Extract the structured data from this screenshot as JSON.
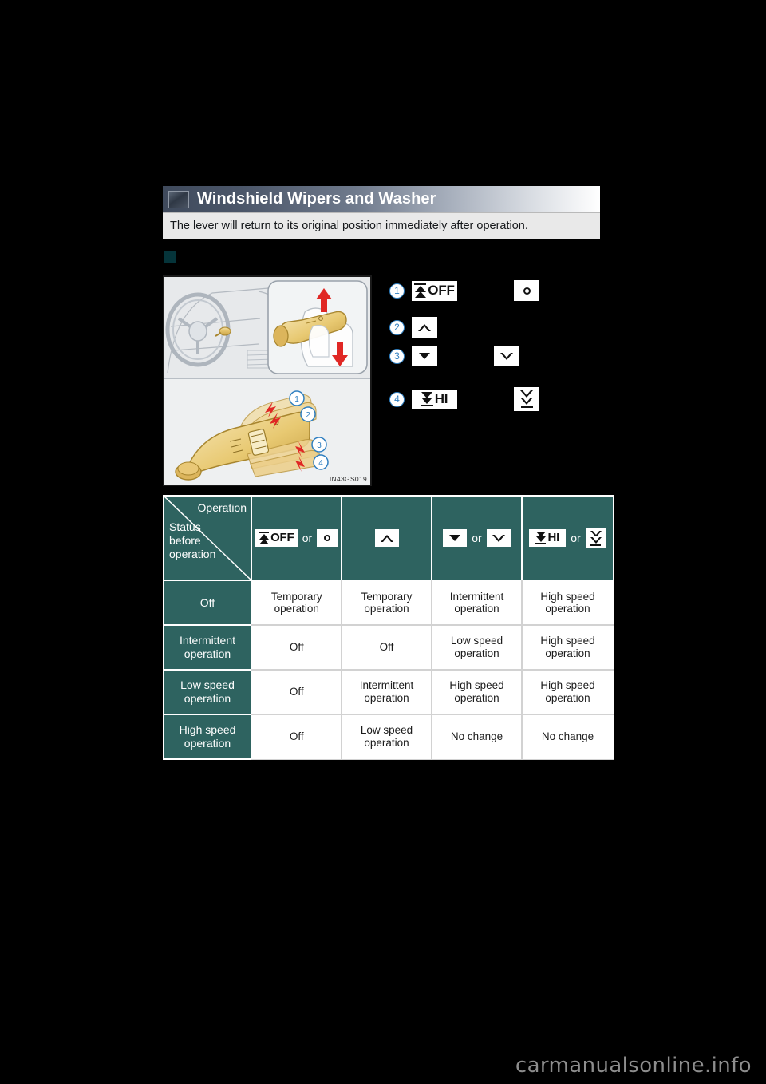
{
  "section": {
    "icon_name": "wiper-thumbnail-icon",
    "title": "Windshield Wipers and Washer",
    "subtitle": "The lever will return to its original position immediately after operation."
  },
  "illustration": {
    "caption_code": "IN43GS019",
    "alt": "Steering column wiper lever with four operating positions"
  },
  "callouts": [
    {
      "num": "1",
      "primary_label": "OFF",
      "primary_icon": "bar-up-arrow-icon",
      "alt_icon": "ring-icon",
      "alt_label": ""
    },
    {
      "num": "2",
      "primary_label": "",
      "primary_icon": "triangle-up-hollow-icon",
      "alt_icon": "",
      "alt_label": ""
    },
    {
      "num": "3",
      "primary_label": "",
      "primary_icon": "triangle-down-solid-icon",
      "alt_icon": "triangle-down-hollow-icon",
      "alt_label": ""
    },
    {
      "num": "4",
      "primary_label": "HI",
      "primary_icon": "bar-down-arrow-icon",
      "alt_icon": "double-down-arrow-bar-icon",
      "alt_label": ""
    }
  ],
  "table": {
    "corner": {
      "operation_label": "Operation",
      "status_label": "Status\nbefore\noperation",
      "status_line1": "Status",
      "status_line2": "before",
      "status_line3": "operation"
    },
    "or_text": "or",
    "columns": [
      {
        "primary_label": "OFF",
        "primary_icon": "bar-up-arrow-icon",
        "alt_icon": "ring-icon",
        "has_or": true
      },
      {
        "primary_label": "",
        "primary_icon": "triangle-up-hollow-icon",
        "alt_icon": "",
        "has_or": false
      },
      {
        "primary_label": "",
        "primary_icon": "triangle-down-solid-icon",
        "alt_icon": "triangle-down-hollow-icon",
        "has_or": true
      },
      {
        "primary_label": "HI",
        "primary_icon": "bar-down-arrow-icon",
        "alt_icon": "double-down-arrow-bar-icon",
        "has_or": true
      }
    ],
    "rows": [
      {
        "label_line1": "Off",
        "label_line2": "",
        "cells": [
          {
            "line1": "Temporary",
            "line2": "operation"
          },
          {
            "line1": "Temporary",
            "line2": "operation"
          },
          {
            "line1": "Intermittent",
            "line2": "operation"
          },
          {
            "line1": "High speed",
            "line2": "operation"
          }
        ]
      },
      {
        "label_line1": "Intermittent",
        "label_line2": "operation",
        "cells": [
          {
            "line1": "Off",
            "line2": ""
          },
          {
            "line1": "Off",
            "line2": ""
          },
          {
            "line1": "Low speed",
            "line2": "operation"
          },
          {
            "line1": "High speed",
            "line2": "operation"
          }
        ]
      },
      {
        "label_line1": "Low speed",
        "label_line2": "operation",
        "cells": [
          {
            "line1": "Off",
            "line2": ""
          },
          {
            "line1": "Intermittent",
            "line2": "operation"
          },
          {
            "line1": "High speed",
            "line2": "operation"
          },
          {
            "line1": "High speed",
            "line2": "operation"
          }
        ]
      },
      {
        "label_line1": "High speed",
        "label_line2": "operation",
        "cells": [
          {
            "line1": "Off",
            "line2": ""
          },
          {
            "line1": "Low speed",
            "line2": "operation"
          },
          {
            "line1": "No change",
            "line2": ""
          },
          {
            "line1": "No change",
            "line2": ""
          }
        ]
      }
    ]
  },
  "watermark": "carmanualsonline.info",
  "colors": {
    "teal": "#2e6360",
    "bullet_teal": "#05343a",
    "callout_blue": "#2f7fc1",
    "header_dark": "#3f4a5c",
    "subbar_gray": "#e9e9e9",
    "page_black": "#000000"
  }
}
